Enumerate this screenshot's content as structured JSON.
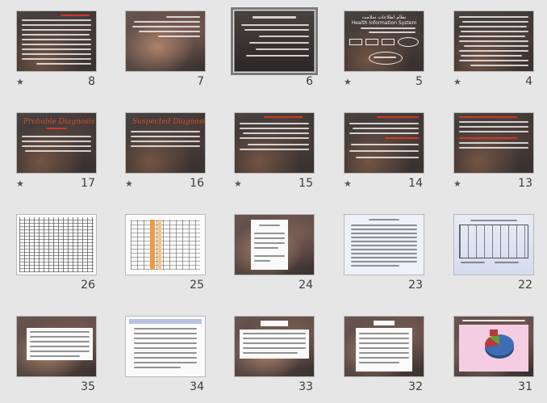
{
  "sorter": {
    "slides": [
      {
        "number": "4",
        "star": true,
        "theme": "dark-text"
      },
      {
        "number": "5",
        "star": true,
        "theme": "diagram",
        "title": "Health Information System",
        "title_fa": "نظام اطلاعات سلامت"
      },
      {
        "number": "6",
        "star": false,
        "theme": "dark-list",
        "selected": true
      },
      {
        "number": "7",
        "star": false,
        "theme": "photo-text"
      },
      {
        "number": "8",
        "star": true,
        "theme": "dark-text-red"
      },
      {
        "number": "13",
        "star": true,
        "theme": "dark-text-red"
      },
      {
        "number": "14",
        "star": true,
        "theme": "dark-text-red"
      },
      {
        "number": "15",
        "star": true,
        "theme": "dark-text"
      },
      {
        "number": "16",
        "star": true,
        "theme": "title-red",
        "title": "Suspected Diagnosis"
      },
      {
        "number": "17",
        "star": true,
        "theme": "title-red",
        "title": "Probable Diagnosis"
      },
      {
        "number": "22",
        "star": false,
        "theme": "table-blue"
      },
      {
        "number": "23",
        "star": false,
        "theme": "doc-lilac"
      },
      {
        "number": "24",
        "star": false,
        "theme": "photo-doc"
      },
      {
        "number": "25",
        "star": false,
        "theme": "table-orange"
      },
      {
        "number": "26",
        "star": false,
        "theme": "table-grid"
      },
      {
        "number": "31",
        "star": false,
        "theme": "chart-pie"
      },
      {
        "number": "32",
        "star": false,
        "theme": "photo-doc2"
      },
      {
        "number": "33",
        "star": false,
        "theme": "photo-doc3"
      },
      {
        "number": "34",
        "star": false,
        "theme": "white-list"
      },
      {
        "number": "35",
        "star": false,
        "theme": "photo-doc4"
      }
    ],
    "star_glyph": "★"
  }
}
